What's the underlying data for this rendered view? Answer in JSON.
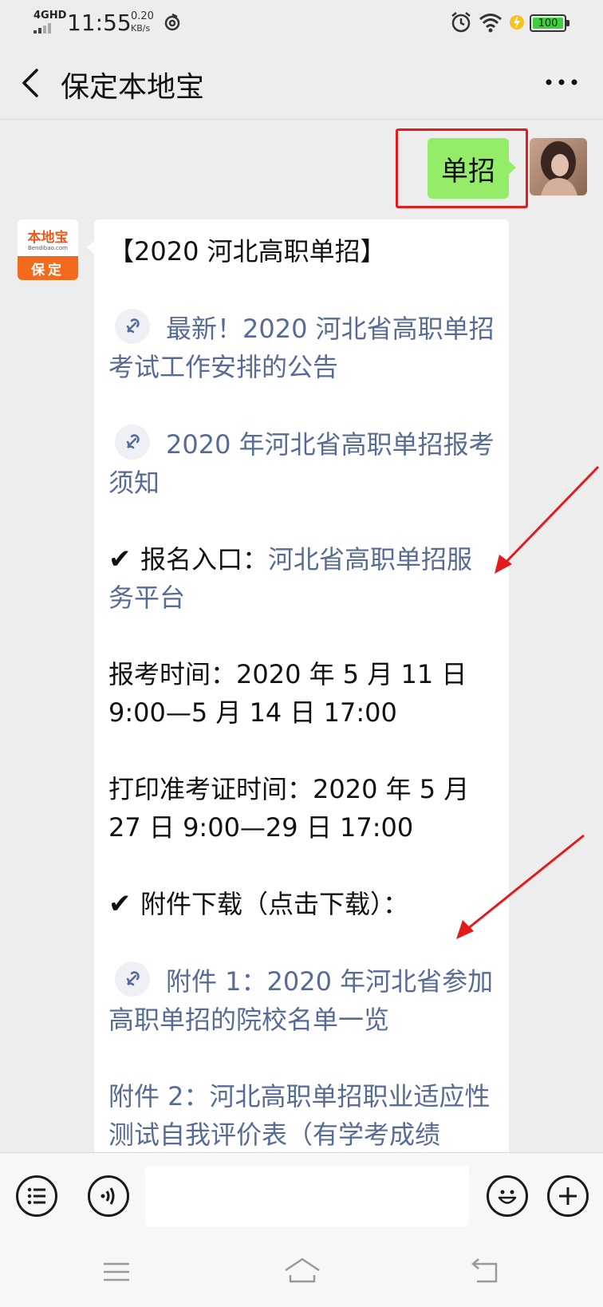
{
  "status_bar": {
    "network": "4GHD",
    "time": "11:55",
    "speed_value": "0.20",
    "speed_unit": "KB/s",
    "battery": "100",
    "icons": [
      "signal-icon",
      "nfc-icon",
      "alarm-icon",
      "wifi-icon",
      "charging-bolt-icon",
      "battery-icon"
    ]
  },
  "header": {
    "title": "保定本地宝",
    "back_icon": "chevron-left-icon",
    "more_icon": "ellipsis-icon"
  },
  "chat": {
    "sent_message": "单招",
    "bot": {
      "logo_text": "本地宝",
      "logo_sub": "Bendibao.com",
      "logo_city": "保定"
    },
    "reply": {
      "title": "【2020 河北高职单招】",
      "link1": "最新！2020 河北省高职单招考试工作安排的公告",
      "link2": "2020 年河北省高职单招报考须知",
      "register_prefix": "报名入口：",
      "register_link": "河北省高职单招服务平台",
      "apply_time": "报考时间：2020 年 5 月 11 日 9:00—5 月 14 日 17:00",
      "print_time": "打印准考证时间：2020 年 5 月 27 日 9:00—29 日 17:00",
      "attachments_heading": "附件下载（点击下载）：",
      "attachment1": "附件 1：2020 年河北省参加高职单招的院校名单一览",
      "attachment2": "附件 2：河北高职单招职业适应性测试自我评价表（有学考成绩"
    }
  },
  "input_bar": {
    "placeholder": "",
    "icons": [
      "list-icon",
      "voice-icon",
      "emoji-icon",
      "add-icon"
    ]
  },
  "nav_bar": {
    "icons": [
      "menu-icon",
      "home-icon",
      "back-icon"
    ]
  },
  "colors": {
    "sent_bubble": "#95ec69",
    "link": "#576b95",
    "highlight": "#e31b1b",
    "background": "#ededed"
  }
}
